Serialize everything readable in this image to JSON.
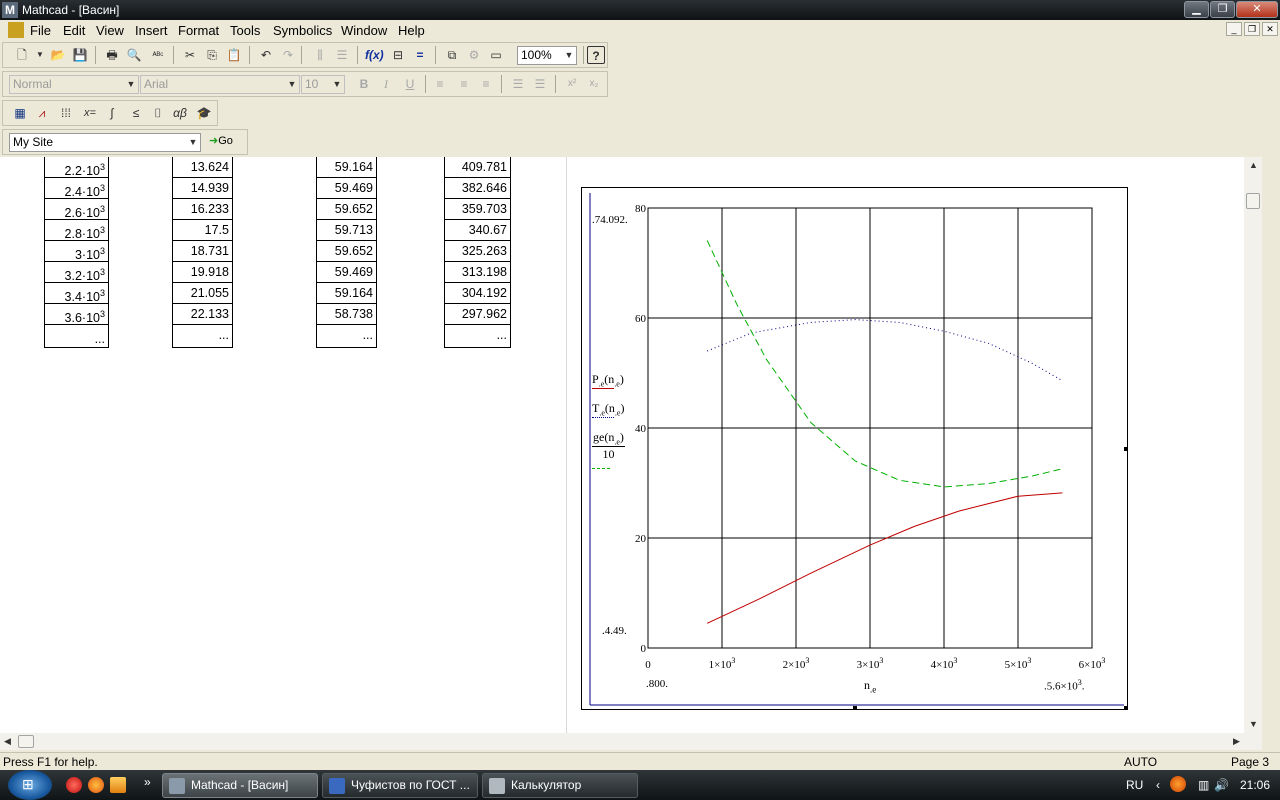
{
  "window": {
    "title": "Mathcad - [Васин]",
    "app_letter": "M"
  },
  "menu": [
    "File",
    "Edit",
    "View",
    "Insert",
    "Format",
    "Tools",
    "Symbolics",
    "Window",
    "Help"
  ],
  "toolbar": {
    "zoom": "100%"
  },
  "format_bar": {
    "style": "Normal",
    "font": "Arial",
    "size": "10"
  },
  "resource_bar": {
    "site": "My Site",
    "go_label": "Go"
  },
  "table": {
    "col1": [
      {
        "m": "2.2·10",
        "e": "3"
      },
      {
        "m": "2.4·10",
        "e": "3"
      },
      {
        "m": "2.6·10",
        "e": "3"
      },
      {
        "m": "2.8·10",
        "e": "3"
      },
      {
        "m": "3·10",
        "e": "3"
      },
      {
        "m": "3.2·10",
        "e": "3"
      },
      {
        "m": "3.4·10",
        "e": "3"
      },
      {
        "m": "3.6·10",
        "e": "3"
      },
      {
        "m": "...",
        "e": ""
      }
    ],
    "col2": [
      "13.624",
      "14.939",
      "16.233",
      "17.5",
      "18.731",
      "19.918",
      "21.055",
      "22.133",
      "..."
    ],
    "col3": [
      "59.164",
      "59.469",
      "59.652",
      "59.713",
      "59.652",
      "59.469",
      "59.164",
      "58.738",
      "..."
    ],
    "col4": [
      "409.781",
      "382.646",
      "359.703",
      "340.67",
      "325.263",
      "313.198",
      "304.192",
      "297.962",
      "..."
    ]
  },
  "plot": {
    "y_top_marker": "74.092",
    "y_bottom_marker": "4.49",
    "x_left_marker": "800",
    "x_right_marker": {
      "m": "5.6×10",
      "e": "3"
    },
    "xlabel": {
      "base": "n",
      "sub": ".e"
    },
    "y_ticks": [
      "80",
      "60",
      "40",
      "20",
      "0"
    ],
    "x_ticks": [
      {
        "m": "0",
        "e": ""
      },
      {
        "m": "1×10",
        "e": "3"
      },
      {
        "m": "2×10",
        "e": "3"
      },
      {
        "m": "3×10",
        "e": "3"
      },
      {
        "m": "4×10",
        "e": "3"
      },
      {
        "m": "5×10",
        "e": "3"
      },
      {
        "m": "6×10",
        "e": "3"
      }
    ],
    "legend": [
      {
        "base": "P",
        "sub": ".e",
        "arg": "n",
        "argsub": ".e",
        "color": "#c00000"
      },
      {
        "base": "T",
        "sub": ".e",
        "arg": "n",
        "argsub": ".e",
        "color": "#000080"
      },
      {
        "base": "ge",
        "sub": "",
        "arg": "n",
        "argsub": ".e",
        "denominator": "10",
        "color": "#00b000"
      }
    ]
  },
  "chart_data": {
    "type": "line",
    "xlim": [
      0,
      6000
    ],
    "ylim": [
      0,
      80
    ],
    "grid": true,
    "series": [
      {
        "name": "P.e(n.e)",
        "color": "#c00000",
        "style": "solid",
        "x": [
          800,
          1500,
          2200,
          3000,
          3600,
          4200,
          5000,
          5600
        ],
        "y": [
          4.49,
          8.9,
          13.6,
          18.7,
          22.1,
          24.9,
          27.6,
          28.2
        ]
      },
      {
        "name": "T.e(n.e)",
        "color": "#000080",
        "style": "dotted",
        "x": [
          800,
          1400,
          2200,
          2800,
          3400,
          4000,
          4600,
          5200,
          5600
        ],
        "y": [
          54.0,
          57.3,
          59.2,
          59.7,
          59.2,
          57.6,
          55.4,
          51.7,
          48.6
        ]
      },
      {
        "name": "ge(n.e)/10",
        "color": "#00b000",
        "style": "dashed",
        "x": [
          800,
          1200,
          1600,
          2200,
          2800,
          3400,
          4000,
          4600,
          5200,
          5600
        ],
        "y": [
          74.092,
          62.5,
          52.5,
          41.0,
          34.0,
          30.5,
          29.3,
          29.9,
          31.3,
          32.6
        ]
      }
    ]
  },
  "status": {
    "help": "Press F1 for help.",
    "mode": "AUTO",
    "page": "Page 3"
  },
  "taskbar": {
    "tasks": [
      "Mathcad - [Васин]",
      "Чуфистов по ГОСТ ...",
      "Калькулятор"
    ],
    "lang": "RU",
    "clock": "21:06"
  }
}
